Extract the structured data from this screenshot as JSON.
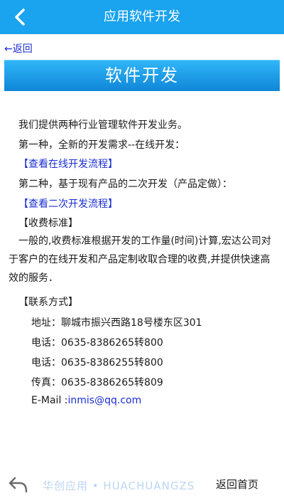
{
  "header": {
    "title": "应用软件开发"
  },
  "nav": {
    "back_link": "←返回"
  },
  "banner": {
    "title": "软件开发"
  },
  "body": {
    "intro": "我们提供两种行业管理软件开发业务。",
    "option1": "第一种，全新的开发需求--在线开发：",
    "option1_link": "【查看在线开发流程】",
    "option2": "第二种，基于现有产品的二次开发（产品定做）：",
    "option2_link": "【查看二次开发流程】",
    "fee_heading": "【收费标准】",
    "fee_text": "一般的,收费标准根据开发的工作量(时间)计算,宏达公司对于客户的在线开发和产品定制收取合理的收费,并提供快速高效的服务．",
    "contact_heading": "【联系方式】",
    "address": "地址：聊城市振兴西路18号楼东区301",
    "phone1": "电话：0635-8386265转800",
    "phone2": "电话：0635-8386255转800",
    "fax": "传真：0635-8386265转809",
    "email_label": "E-Mail :",
    "email_value": "inmis@qq.com"
  },
  "footer": {
    "watermark": "华创应用 • HUACHUANGZS",
    "home_link": "返回首页"
  },
  "colors": {
    "header_bg": "#1aa3ee",
    "link": "#1b2fd0"
  },
  "icons": {
    "back": "chevron-left-icon",
    "undo": "undo-arrow-icon"
  }
}
